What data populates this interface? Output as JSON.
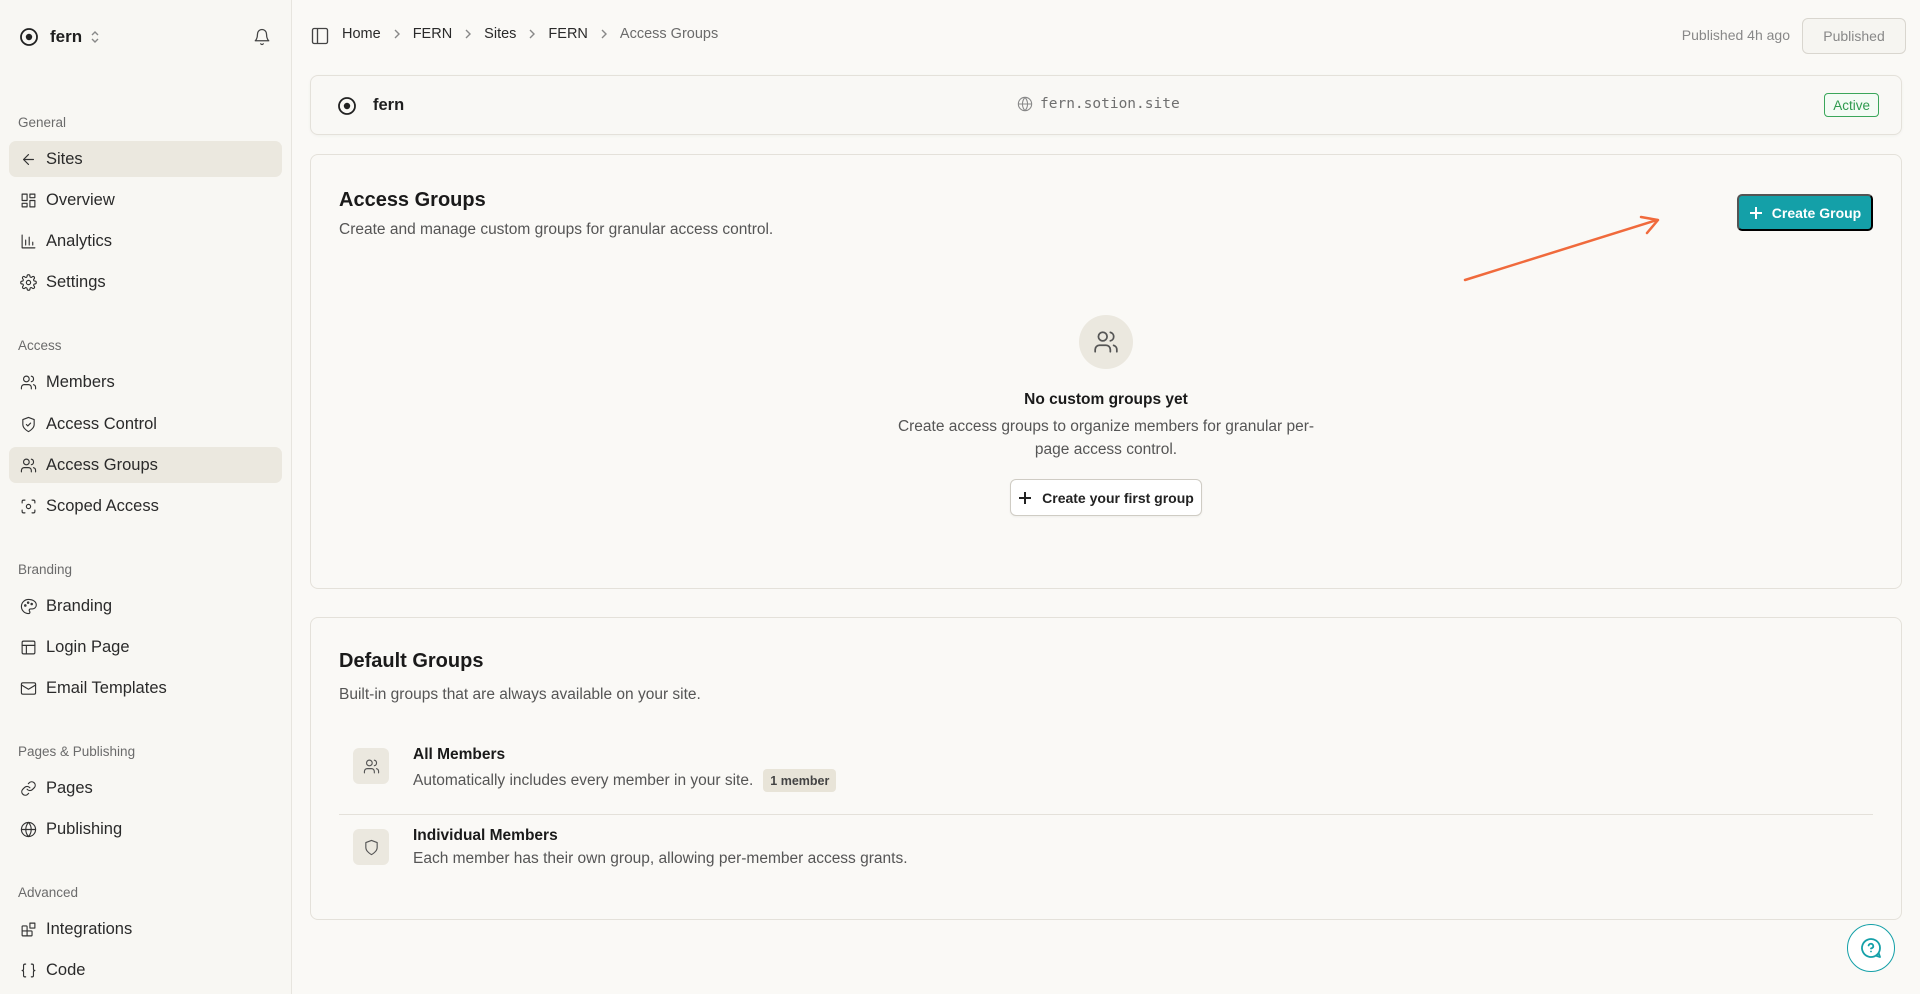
{
  "workspace": {
    "name": "fern"
  },
  "sidebar": {
    "sections": [
      {
        "label": "General",
        "items": [
          {
            "label": "Sites",
            "icon": "arrow-left-icon",
            "active": true
          },
          {
            "label": "Overview",
            "icon": "dashboard-icon"
          },
          {
            "label": "Analytics",
            "icon": "bar-chart-icon"
          },
          {
            "label": "Settings",
            "icon": "gear-icon"
          }
        ]
      },
      {
        "label": "Access",
        "items": [
          {
            "label": "Members",
            "icon": "users-icon"
          },
          {
            "label": "Access Control",
            "icon": "shield-check-icon"
          },
          {
            "label": "Access Groups",
            "icon": "users-icon",
            "active": true
          },
          {
            "label": "Scoped Access",
            "icon": "scan-icon"
          }
        ]
      },
      {
        "label": "Branding",
        "items": [
          {
            "label": "Branding",
            "icon": "palette-icon"
          },
          {
            "label": "Login Page",
            "icon": "layout-icon"
          },
          {
            "label": "Email Templates",
            "icon": "mail-icon"
          }
        ]
      },
      {
        "label": "Pages & Publishing",
        "items": [
          {
            "label": "Pages",
            "icon": "link-icon"
          },
          {
            "label": "Publishing",
            "icon": "globe-icon"
          }
        ]
      },
      {
        "label": "Advanced",
        "items": [
          {
            "label": "Integrations",
            "icon": "blocks-icon"
          },
          {
            "label": "Code",
            "icon": "braces-icon"
          }
        ]
      }
    ]
  },
  "breadcrumbs": [
    "Home",
    "FERN",
    "Sites",
    "FERN",
    "Access Groups"
  ],
  "publish": {
    "status_text": "Published 4h ago",
    "button_label": "Published"
  },
  "site": {
    "name": "fern",
    "url": "fern.sotion.site",
    "status": "Active"
  },
  "access_groups": {
    "title": "Access Groups",
    "subtitle": "Create and manage custom groups for granular access control.",
    "create_button": "Create Group",
    "empty_title": "No custom groups yet",
    "empty_desc": "Create access groups to organize members for granular per-page access control.",
    "empty_button": "Create your first group"
  },
  "default_groups": {
    "title": "Default Groups",
    "subtitle": "Built-in groups that are always available on your site.",
    "groups": [
      {
        "name": "All Members",
        "description": "Automatically includes every member in your site.",
        "badge": "1 member",
        "icon": "users-icon"
      },
      {
        "name": "Individual Members",
        "description": "Each member has their own group, allowing per-member access grants.",
        "icon": "shield-icon"
      }
    ]
  },
  "colors": {
    "accent": "#14a0a8",
    "annotation_arrow": "#f06a3c",
    "active_badge": "#2e9a4e"
  }
}
